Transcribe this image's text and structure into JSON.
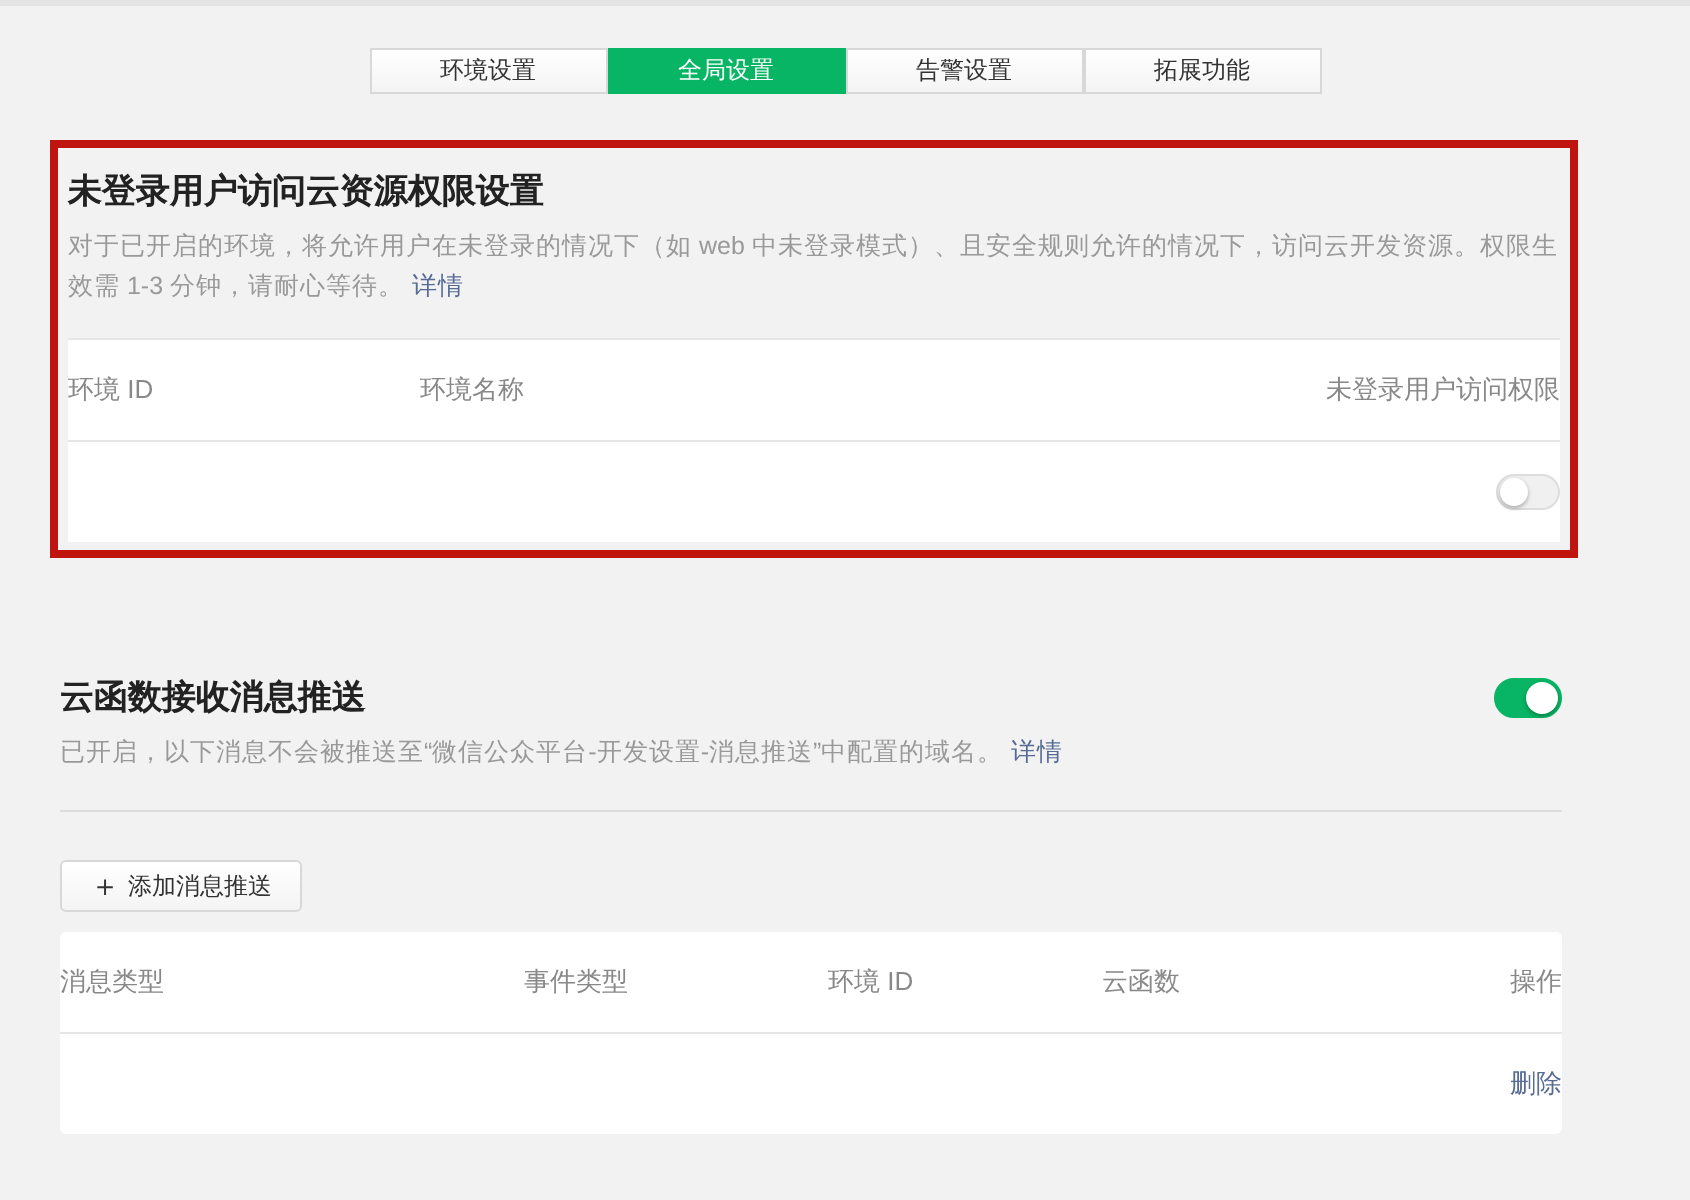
{
  "tabs": [
    {
      "label": "环境设置",
      "selected": false
    },
    {
      "label": "全局设置",
      "selected": true
    },
    {
      "label": "告警设置",
      "selected": false
    },
    {
      "label": "拓展功能",
      "selected": false
    }
  ],
  "unauth_access": {
    "highlighted": true,
    "title": "未登录用户访问云资源权限设置",
    "description": "对于已开启的环境，将允许用户在未登录的情况下（如 web 中未登录模式）、且安全规则允许的情况下，访问云开发资源。权限生效需 1-3 分钟，请耐心等待。",
    "link": "详情",
    "table": {
      "columns": [
        "环境 ID",
        "环境名称",
        "未登录用户访问权限"
      ],
      "rows": [
        {
          "on": false
        }
      ]
    }
  },
  "message_push": {
    "title": "云函数接收消息推送",
    "on": true,
    "description": "已开启，以下消息不会被推送至“微信公众平台-开发设置-消息推送”中配置的域名。",
    "link": "详情",
    "add_button": {
      "icon": "＋",
      "label": "添加消息推送"
    },
    "table": {
      "columns": [
        "消息类型",
        "事件类型",
        "环境 ID",
        "云函数",
        "操作"
      ],
      "rows": [
        {
          "action": "删除"
        }
      ]
    }
  }
}
